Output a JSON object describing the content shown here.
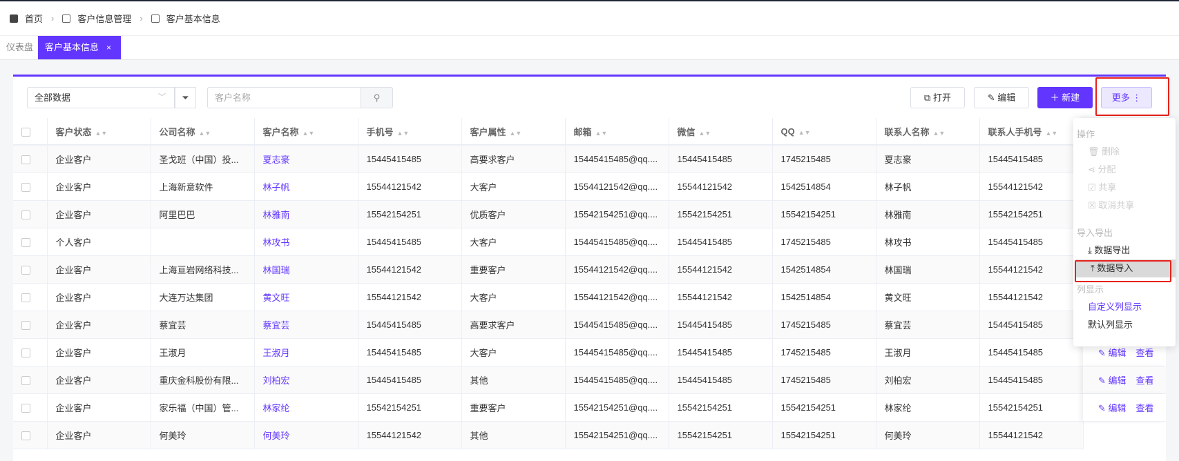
{
  "breadcrumb": [
    {
      "label": "首页",
      "icon": "home-icon"
    },
    {
      "label": "客户信息管理",
      "icon": "module-icon"
    },
    {
      "label": "客户基本信息",
      "icon": "module-icon"
    }
  ],
  "tabs": {
    "dashboard": "仪表盘",
    "active": "客户基本信息",
    "close": "×"
  },
  "toolbar": {
    "scope_select": "全部数据",
    "search_placeholder": "客户名称",
    "open": "打开",
    "edit": "编辑",
    "new": "新建",
    "more": "更多 ⋮"
  },
  "colors": {
    "accent": "#6236ff",
    "highlight_box": "#e8201a"
  },
  "table": {
    "columns": [
      "客户状态",
      "公司名称",
      "客户名称",
      "手机号",
      "客户属性",
      "邮箱",
      "微信",
      "QQ",
      "联系人名称",
      "联系人手机号"
    ],
    "rows": [
      [
        "企业客户",
        "圣戈班（中国）投...",
        "夏志豪",
        "15445415485",
        "高要求客户",
        "15445415485@qq....",
        "15445415485",
        "1745215485",
        "夏志豪",
        "15445415485"
      ],
      [
        "企业客户",
        "上海新意软件",
        "林子帆",
        "15544121542",
        "大客户",
        "15544121542@qq....",
        "15544121542",
        "1542514854",
        "林子帆",
        "15544121542"
      ],
      [
        "企业客户",
        "阿里巴巴",
        "林雅南",
        "15542154251",
        "优质客户",
        "15542154251@qq....",
        "15542154251",
        "15542154251",
        "林雅南",
        "15542154251"
      ],
      [
        "个人客户",
        "",
        "林攻书",
        "15445415485",
        "大客户",
        "15445415485@qq....",
        "15445415485",
        "1745215485",
        "林攻书",
        "15445415485"
      ],
      [
        "企业客户",
        "上海亘岩网络科技...",
        "林国瑞",
        "15544121542",
        "重要客户",
        "15544121542@qq....",
        "15544121542",
        "1542514854",
        "林国瑞",
        "15544121542"
      ],
      [
        "企业客户",
        "大连万达集团",
        "黄文旺",
        "15544121542",
        "大客户",
        "15544121542@qq....",
        "15544121542",
        "1542514854",
        "黄文旺",
        "15544121542"
      ],
      [
        "企业客户",
        "蔡宜芸",
        "蔡宜芸",
        "15445415485",
        "高要求客户",
        "15445415485@qq....",
        "15445415485",
        "1745215485",
        "蔡宜芸",
        "15445415485"
      ],
      [
        "企业客户",
        "王淑月",
        "王淑月",
        "15445415485",
        "大客户",
        "15445415485@qq....",
        "15445415485",
        "1745215485",
        "王淑月",
        "15445415485"
      ],
      [
        "企业客户",
        "重庆金科股份有限...",
        "刘柏宏",
        "15445415485",
        "其他",
        "15445415485@qq....",
        "15445415485",
        "1745215485",
        "刘柏宏",
        "15445415485"
      ],
      [
        "企业客户",
        "家乐福（中国）管...",
        "林家纶",
        "15542154251",
        "重要客户",
        "15542154251@qq....",
        "15542154251",
        "15542154251",
        "林家纶",
        "15542154251"
      ],
      [
        "企业客户",
        "何美玲",
        "何美玲",
        "15544121542",
        "其他",
        "15542154251@qq....",
        "15542154251",
        "15542154251",
        "何美玲",
        "15544121542"
      ]
    ],
    "row_actions": {
      "edit": "编辑",
      "view": "查看"
    }
  },
  "more_menu": {
    "section_ops": "操作",
    "delete": "删除",
    "assign": "分配",
    "share": "共享",
    "unshare": "取消共享",
    "section_io": "导入导出",
    "export": "数据导出",
    "import": "数据导入",
    "section_cols": "列显示",
    "custom_cols": "自定义列显示",
    "default_cols": "默认列显示"
  }
}
